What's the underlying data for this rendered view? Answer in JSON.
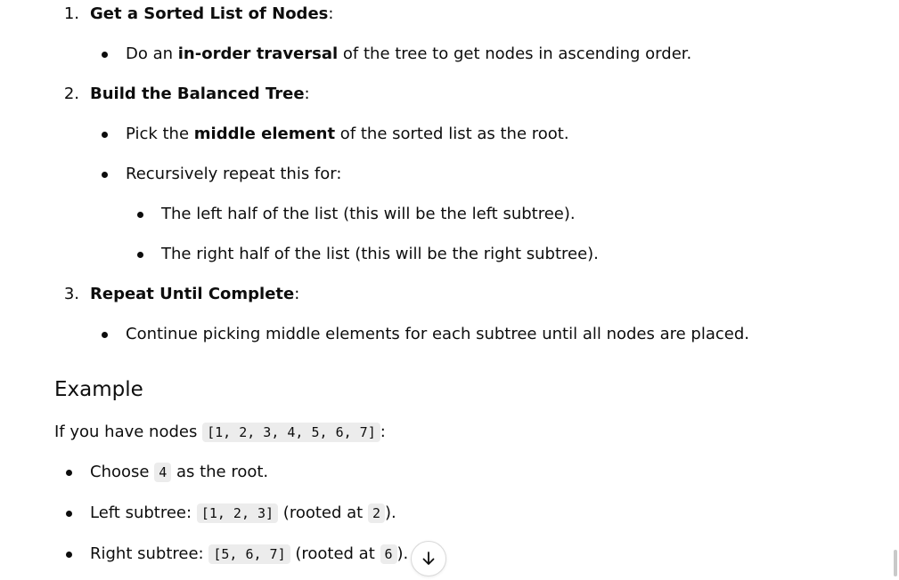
{
  "steps": [
    {
      "number": "1.",
      "title": "Get a Sorted List of Nodes",
      "colon": ":",
      "bullets": [
        {
          "pre": "Do an ",
          "bold": "in-order traversal",
          "post": " of the tree to get nodes in ascending order."
        }
      ]
    },
    {
      "number": "2.",
      "title": "Build the Balanced Tree",
      "colon": ":",
      "bullets": [
        {
          "pre": "Pick the ",
          "bold": "middle element",
          "post": " of the sorted list as the root."
        },
        {
          "text": "Recursively repeat this for:"
        }
      ],
      "sub_bullets": [
        "The left half of the list (this will be the left subtree).",
        "The right half of the list (this will be the right subtree)."
      ]
    },
    {
      "number": "3.",
      "title": "Repeat Until Complete",
      "colon": ":",
      "bullets": [
        {
          "text": "Continue picking middle elements for each subtree until all nodes are placed."
        }
      ]
    }
  ],
  "example": {
    "heading": "Example",
    "intro_pre": "If you have nodes ",
    "intro_code": "[1, 2, 3, 4, 5, 6, 7]",
    "intro_post": ":",
    "items": [
      {
        "pre": "Choose ",
        "code": "4",
        "post": " as the root."
      },
      {
        "pre": "Left subtree: ",
        "code": "[1, 2, 3]",
        "mid": " (rooted at ",
        "code2": "2",
        "post": ")."
      },
      {
        "pre": "Right subtree: ",
        "code": "[5, 6, 7]",
        "mid": " (rooted at ",
        "code2": "6",
        "post": ")."
      }
    ]
  },
  "scroll_button": {
    "icon": "arrow-down-icon"
  }
}
